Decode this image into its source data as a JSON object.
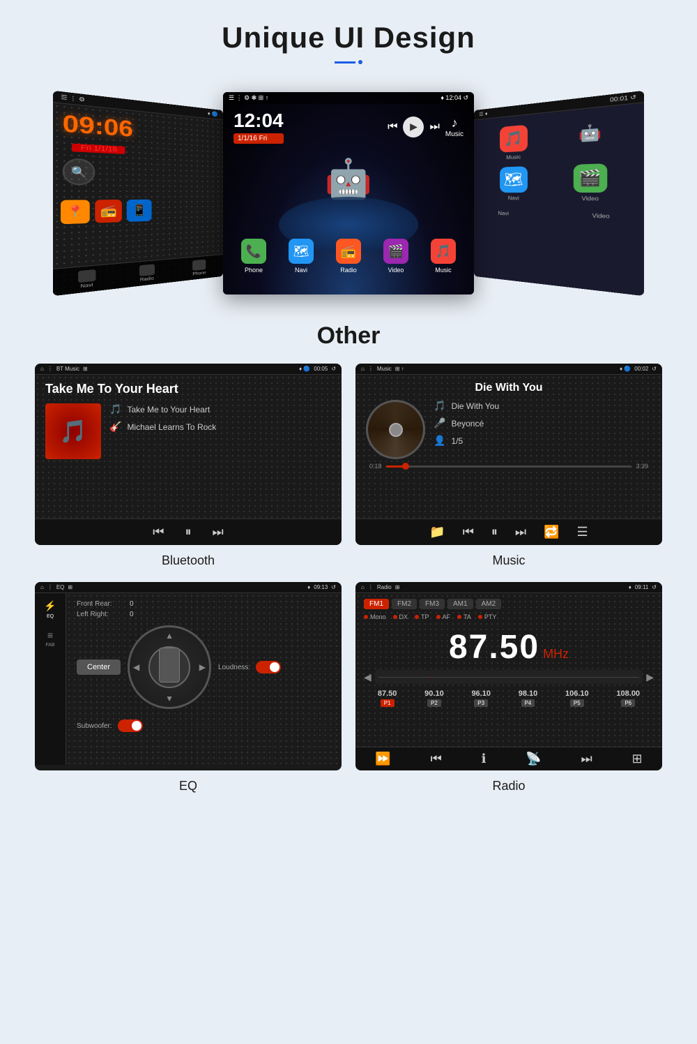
{
  "header": {
    "title": "Unique UI Design",
    "subtitle_underline": true
  },
  "ui_panel": {
    "left_screen": {
      "time": "09:06",
      "date": "Fri 1/1/16",
      "nav_items": [
        "Navi",
        "Radio",
        "Phone"
      ]
    },
    "center_screen": {
      "time": "12:04",
      "date": "1/1/16",
      "day": "Fri",
      "apps": [
        "Phone",
        "Navi",
        "Radio",
        "Video",
        "Music"
      ],
      "media_label": "Music"
    },
    "right_screen": {
      "apps": [
        "Music",
        "Android",
        "Navi",
        "Video"
      ]
    }
  },
  "other_section": {
    "title": "Other",
    "bluetooth_screen": {
      "status_left": "BT Music",
      "status_right": "00:05",
      "song_title": "Take Me To Your Heart",
      "song_name": "Take Me to Your Heart",
      "artist": "Michael Learns To Rock",
      "label": "Bluetooth"
    },
    "music_screen": {
      "status_left": "Music",
      "status_right": "00:02",
      "song_title": "Die With You",
      "song_name": "Die With You",
      "artist": "Beyoncé",
      "track": "1/5",
      "time_current": "0:18",
      "time_total": "3:39",
      "label": "Music"
    },
    "eq_screen": {
      "status_left": "EQ",
      "status_right": "09:13",
      "front_rear": "0",
      "left_right": "0",
      "loudness": "Off",
      "subwoofer": "Off",
      "sidebar_items": [
        "EQ",
        "FAB"
      ],
      "label": "EQ"
    },
    "radio_screen": {
      "status_left": "Radio",
      "status_right": "09:11",
      "bands": [
        "FM1",
        "FM2",
        "FM3",
        "AM1",
        "AM2"
      ],
      "active_band": "FM1",
      "options": [
        "Mono",
        "DX",
        "TP",
        "AF",
        "TA",
        "PTY"
      ],
      "frequency": "87.50",
      "unit": "MHz",
      "presets": [
        {
          "freq": "87.50",
          "num": "P1",
          "active": true
        },
        {
          "freq": "90.10",
          "num": "P2",
          "active": false
        },
        {
          "freq": "96.10",
          "num": "P3",
          "active": false
        },
        {
          "freq": "98.10",
          "num": "P4",
          "active": false
        },
        {
          "freq": "106.10",
          "num": "P5",
          "active": false
        },
        {
          "freq": "108.00",
          "num": "P6",
          "active": false
        }
      ],
      "label": "Radio"
    }
  }
}
